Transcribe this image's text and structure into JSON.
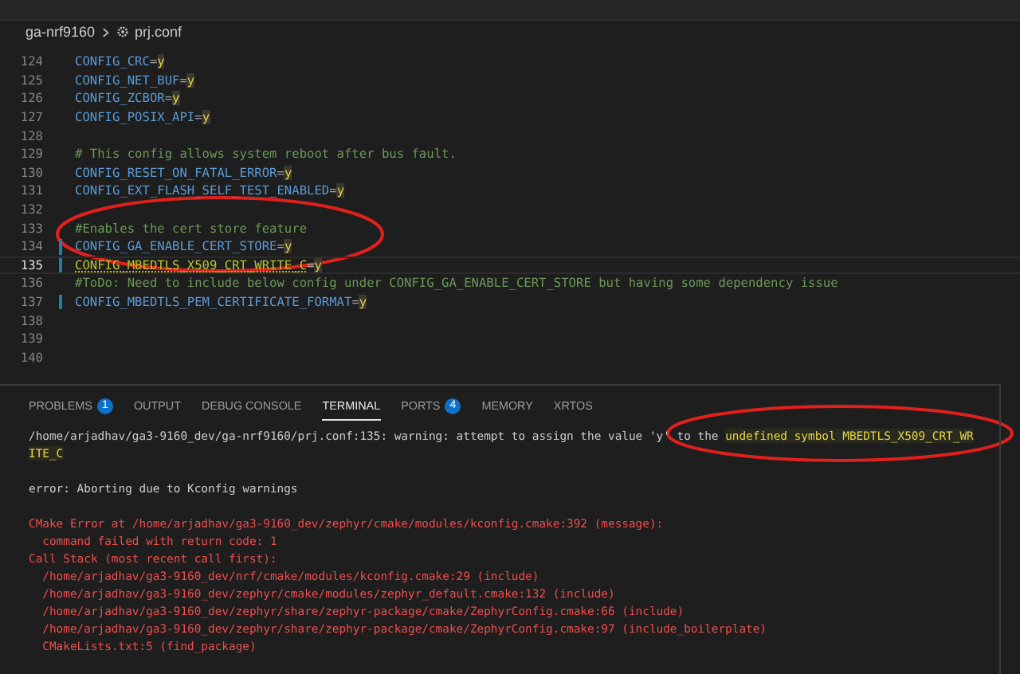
{
  "breadcrumb": {
    "folder": "ga-nrf9160",
    "file": "prj.conf"
  },
  "editor": {
    "lines": [
      {
        "number": "124",
        "kind": "setting",
        "key": "CONFIG_CRC",
        "sep": "=",
        "value": "y",
        "modified": false,
        "current": false
      },
      {
        "number": "125",
        "kind": "setting",
        "key": "CONFIG_NET_BUF",
        "sep": "=",
        "value": "y",
        "modified": false,
        "current": false
      },
      {
        "number": "126",
        "kind": "setting",
        "key": "CONFIG_ZCBOR",
        "sep": "=",
        "value": "y",
        "modified": false,
        "current": false
      },
      {
        "number": "127",
        "kind": "setting",
        "key": "CONFIG_POSIX_API",
        "sep": "=",
        "value": "y",
        "modified": false,
        "current": false
      },
      {
        "number": "128",
        "kind": "empty",
        "modified": false,
        "current": false
      },
      {
        "number": "129",
        "kind": "comment",
        "text": "# This config allows system reboot after bus fault.",
        "modified": false,
        "current": false
      },
      {
        "number": "130",
        "kind": "setting",
        "key": "CONFIG_RESET_ON_FATAL_ERROR",
        "sep": "=",
        "value": "y",
        "modified": false,
        "current": false
      },
      {
        "number": "131",
        "kind": "setting",
        "key": "CONFIG_EXT_FLASH_SELF_TEST_ENABLED",
        "sep": "=",
        "value": "y",
        "modified": false,
        "current": false
      },
      {
        "number": "132",
        "kind": "empty",
        "modified": false,
        "current": false
      },
      {
        "number": "133",
        "kind": "comment",
        "text": "#Enables the cert store feature",
        "modified": false,
        "current": false
      },
      {
        "number": "134",
        "kind": "setting",
        "key": "CONFIG_GA_ENABLE_CERT_STORE",
        "sep": "=",
        "value": "y",
        "modified": true,
        "current": false
      },
      {
        "number": "135",
        "kind": "setting",
        "key": "CONFIG_MBEDTLS_X509_CRT_WRITE_C",
        "sep": "=",
        "value": "y",
        "modified": true,
        "current": true
      },
      {
        "number": "136",
        "kind": "comment",
        "text": "#ToDo: Need to include below config under CONFIG_GA_ENABLE_CERT_STORE but having some dependency issue",
        "modified": false,
        "current": false
      },
      {
        "number": "137",
        "kind": "setting",
        "key": "CONFIG_MBEDTLS_PEM_CERTIFICATE_FORMAT",
        "sep": "=",
        "value": "y",
        "modified": true,
        "current": false
      },
      {
        "number": "138",
        "kind": "empty",
        "modified": false,
        "current": false
      },
      {
        "number": "139",
        "kind": "empty",
        "modified": false,
        "current": false
      },
      {
        "number": "140",
        "kind": "empty",
        "modified": false,
        "current": false
      }
    ]
  },
  "panel": {
    "tabs": [
      {
        "label": "PROBLEMS",
        "badge": "1",
        "selected": false
      },
      {
        "label": "OUTPUT",
        "selected": false
      },
      {
        "label": "DEBUG CONSOLE",
        "selected": false
      },
      {
        "label": "TERMINAL",
        "selected": true
      },
      {
        "label": "PORTS",
        "badge": "4",
        "selected": false
      },
      {
        "label": "MEMORY",
        "selected": false
      },
      {
        "label": "XRTOS",
        "selected": false
      }
    ],
    "terminal": [
      {
        "lines": [
          {
            "kind": "plain",
            "segments": [
              {
                "text": "/home/arjadhav/ga3-9160_dev/ga-nrf9160/prj.conf:135: warning: attempt to assign the value 'y' to the ",
                "highlight": false
              },
              {
                "text": "undefined symbol MBEDTLS_X509_CRT_WR",
                "highlight": true
              }
            ]
          },
          {
            "kind": "plain",
            "segments": [
              {
                "text": "ITE_C",
                "highlight": true
              }
            ]
          }
        ]
      },
      {
        "lines": [
          {
            "kind": "plain",
            "segments": [
              {
                "text": "error: Aborting due to Kconfig warnings",
                "highlight": false
              }
            ]
          }
        ]
      },
      {
        "lines": [
          {
            "kind": "error",
            "segments": [
              {
                "text": "CMake Error at /home/arjadhav/ga3-9160_dev/zephyr/cmake/modules/kconfig.cmake:392 (message):",
                "highlight": false
              }
            ]
          },
          {
            "kind": "error",
            "segments": [
              {
                "text": "  command failed with return code: 1",
                "highlight": false
              }
            ]
          },
          {
            "kind": "error",
            "segments": [
              {
                "text": "Call Stack (most recent call first):",
                "highlight": false
              }
            ]
          },
          {
            "kind": "error",
            "segments": [
              {
                "text": "  /home/arjadhav/ga3-9160_dev/nrf/cmake/modules/kconfig.cmake:29 (include)",
                "highlight": false
              }
            ]
          },
          {
            "kind": "error",
            "segments": [
              {
                "text": "  /home/arjadhav/ga3-9160_dev/zephyr/cmake/modules/zephyr_default.cmake:132 (include)",
                "highlight": false
              }
            ]
          },
          {
            "kind": "error",
            "segments": [
              {
                "text": "  /home/arjadhav/ga3-9160_dev/zephyr/share/zephyr-package/cmake/ZephyrConfig.cmake:66 (include)",
                "highlight": false
              }
            ]
          },
          {
            "kind": "error",
            "segments": [
              {
                "text": "  /home/arjadhav/ga3-9160_dev/zephyr/share/zephyr-package/cmake/ZephyrConfig.cmake:97 (include_boilerplate)",
                "highlight": false
              }
            ]
          },
          {
            "kind": "error",
            "segments": [
              {
                "text": "  CMakeLists.txt:5 (find_package)",
                "highlight": false
              }
            ]
          }
        ]
      }
    ]
  }
}
